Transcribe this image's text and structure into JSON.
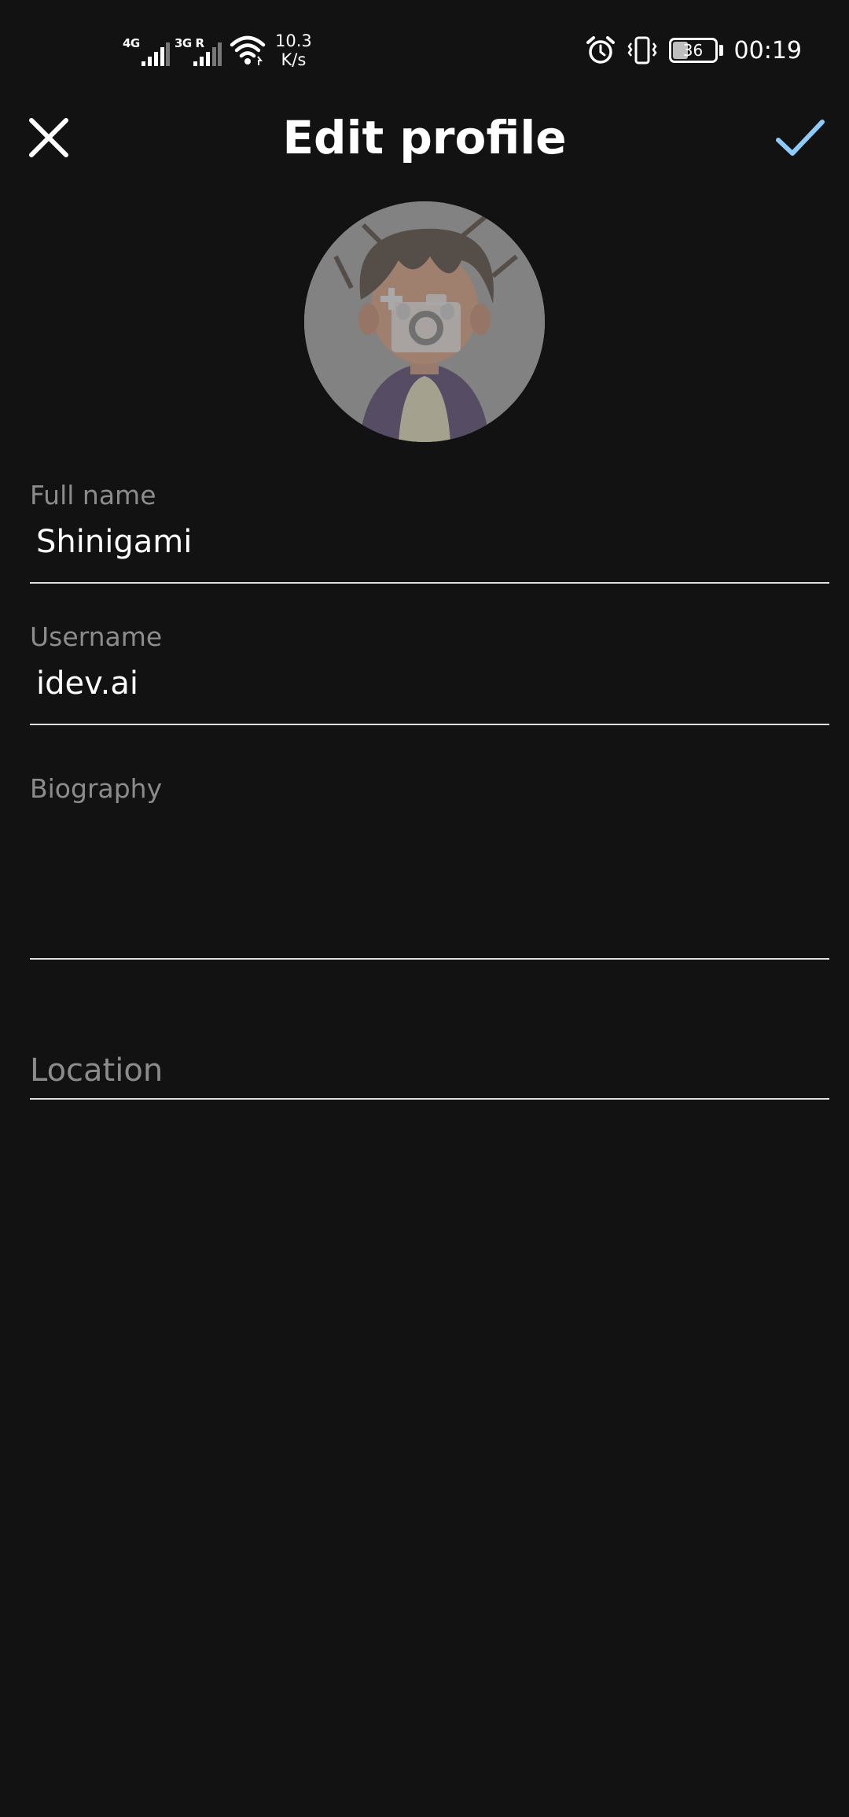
{
  "status_bar": {
    "net1_tag": "4G",
    "net2_tag": "3G R",
    "speed_value": "10.3",
    "speed_unit": "K/s",
    "battery_level": "36",
    "time": "00:19"
  },
  "toolbar": {
    "title": "Edit profile",
    "close_icon": "close-icon",
    "confirm_icon": "check-icon",
    "accent_color": "#90CAF9"
  },
  "avatar": {
    "overlay_icon": "add-photo-icon"
  },
  "form": {
    "full_name_label": "Full name",
    "full_name_value": "Shinigami",
    "username_label": "Username",
    "username_value": "idev.ai",
    "biography_label": "Biography",
    "biography_value": "",
    "location_placeholder": "Location",
    "location_value": ""
  }
}
